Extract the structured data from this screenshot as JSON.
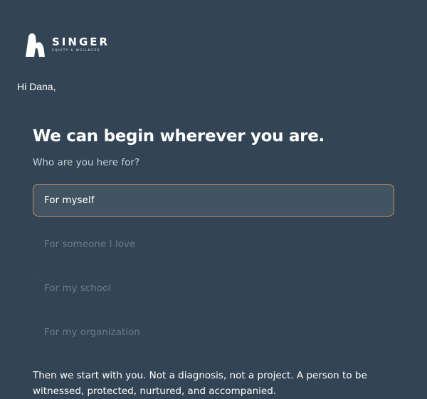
{
  "brand": {
    "name": "SINGER",
    "tagline": "EQUITY & WELLNESS",
    "logo_icon": "singer-logo-mark"
  },
  "greeting": "Hi Dana,",
  "heading": "We can begin wherever you are.",
  "question": "Who are you here for?",
  "options": [
    {
      "label": "For myself",
      "selected": true
    },
    {
      "label": "For someone I love",
      "selected": false
    },
    {
      "label": "For my school",
      "selected": false
    },
    {
      "label": "For my organization",
      "selected": false
    }
  ],
  "body_text": "Then we start with you. Not a diagnosis, not a project. A person to be witnessed, protected, nurtured, and accompanied.",
  "colors": {
    "background": "#334555",
    "selected_border": "#c98a65",
    "selected_fill": "#425462"
  }
}
